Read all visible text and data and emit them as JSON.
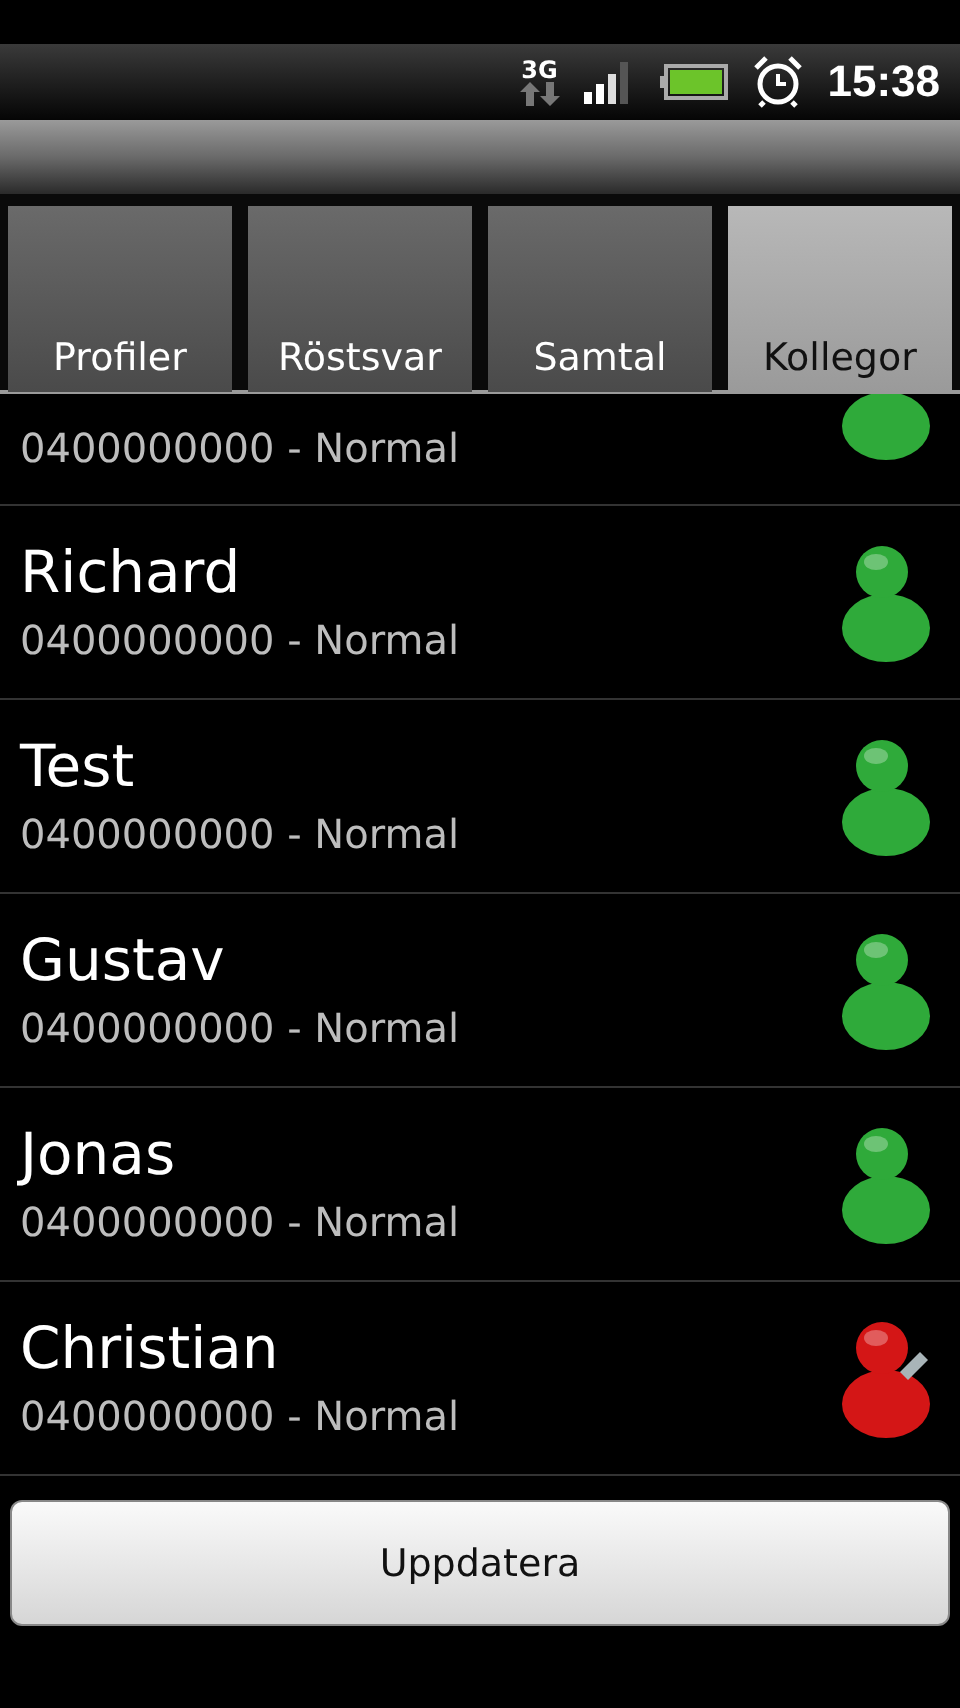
{
  "status_bar": {
    "network": "3G",
    "time": "15:38"
  },
  "tabs": [
    {
      "label": "Profiler",
      "selected": false
    },
    {
      "label": "Röstsvar",
      "selected": false
    },
    {
      "label": "Samtal",
      "selected": false
    },
    {
      "label": "Kollegor",
      "selected": true
    }
  ],
  "colleagues": [
    {
      "kind": "partial",
      "detail": "0400000000 - Normal",
      "color": "#2faa3a",
      "on_call": false
    },
    {
      "kind": "full",
      "name": "Richard",
      "detail": "0400000000 - Normal",
      "color": "#2faa3a",
      "on_call": false
    },
    {
      "kind": "full",
      "name": "Test",
      "detail": "0400000000 - Normal",
      "color": "#2faa3a",
      "on_call": false
    },
    {
      "kind": "full",
      "name": "Gustav",
      "detail": "0400000000 - Normal",
      "color": "#2faa3a",
      "on_call": false
    },
    {
      "kind": "full",
      "name": "Jonas",
      "detail": "0400000000 - Normal",
      "color": "#2faa3a",
      "on_call": false
    },
    {
      "kind": "full",
      "name": "Christian",
      "detail": "0400000000 - Normal",
      "color": "#d41616",
      "on_call": true
    }
  ],
  "button": "Uppdatera"
}
